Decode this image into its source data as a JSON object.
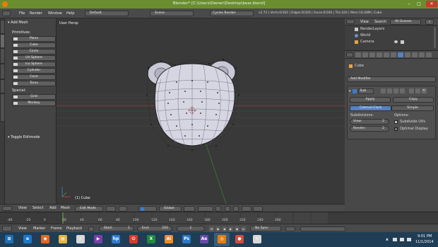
{
  "window": {
    "title": "Blender* [C:\\Users\\Owner\\Desktop\\bear.blend]",
    "minimize": "–",
    "maximize": "□",
    "close": "✕"
  },
  "info_header": {
    "menus": [
      "File",
      "Render",
      "Window",
      "Help"
    ],
    "screen_layout": "Default",
    "scene": "Scene",
    "render_engine": "Cycles Render",
    "stats": "v2.72 | Verts:0/162 | Edges:0/320 | Faces:0/160 | Tris:320 | Mem:16.08M | Cube"
  },
  "toolshelf": {
    "add_meshes_header": "Add Mesh",
    "primitives_label": "Primitives:",
    "primitives": [
      "Plane",
      "Cube",
      "Circle",
      "UV Sphere",
      "Ico Sphere",
      "Cylinder",
      "Cone",
      "Torus"
    ],
    "special_label": "Special:",
    "special": [
      "Grid",
      "Monkey"
    ],
    "toggle_editmode": "Toggle Editmode"
  },
  "viewport": {
    "view_label": "User Persp",
    "object_label": "(1) Cube"
  },
  "viewport_header": {
    "menus": [
      "View",
      "Select",
      "Add",
      "Mesh"
    ],
    "mode": "Edit Mode",
    "orientation": "Global"
  },
  "outliner": {
    "menus": [
      "View",
      "Search"
    ],
    "filter": "All Scenes",
    "items": [
      "RenderLayers",
      "World",
      "Camera"
    ]
  },
  "properties": {
    "object_name": "Cube",
    "add_modifier": "Add Modifier",
    "modifier_name": "Sub",
    "apply_button": "Apply",
    "copy_button": "Copy",
    "catmull_tab": "Catmull-Clark",
    "simple_tab": "Simple",
    "subdivisions_label": "Subdivisions:",
    "options_label": "Options:",
    "view_field": "View:",
    "view_value": "2",
    "render_field": "Render:",
    "render_value": "2",
    "subdivide_uvs": "Subdivide UVs",
    "optimal_display": "Optimal Display"
  },
  "timeline": {
    "ruler": [
      "-40",
      "-20",
      "0",
      "20",
      "40",
      "60",
      "80",
      "100",
      "120",
      "140",
      "160",
      "180",
      "200",
      "220",
      "240",
      "260"
    ],
    "menus": [
      "View",
      "Marker",
      "Frame",
      "Playback"
    ],
    "start_label": "Start:",
    "start_value": "1",
    "end_label": "End:",
    "end_value": "250",
    "current_frame": "1",
    "sync": "No Sync"
  },
  "taskbar": {
    "apps": [
      {
        "name": "ie",
        "color": "#1e78c8",
        "glyph": "e"
      },
      {
        "name": "firefox",
        "color": "#e8641e",
        "glyph": "◉"
      },
      {
        "name": "explorer",
        "color": "#e6b53c",
        "glyph": "▤"
      },
      {
        "name": "itunes",
        "color": "#d8d8d8",
        "glyph": "♪"
      },
      {
        "name": "media",
        "color": "#7a3fa8",
        "glyph": "▶"
      },
      {
        "name": "hp",
        "color": "#2f7bd1",
        "glyph": "hp"
      },
      {
        "name": "power",
        "color": "#d73a27",
        "glyph": "⏻"
      },
      {
        "name": "excel",
        "color": "#1f8a3c",
        "glyph": "X"
      },
      {
        "name": "illustrator",
        "color": "#f28c1e",
        "glyph": "Ai"
      },
      {
        "name": "photoshop",
        "color": "#2a78c6",
        "glyph": "Ps"
      },
      {
        "name": "aftereffects",
        "color": "#6a4aa8",
        "glyph": "Ae"
      },
      {
        "name": "blender",
        "color": "#e87d0d",
        "glyph": "◎"
      },
      {
        "name": "chrome",
        "color": "#d34b3b",
        "glyph": "●"
      },
      {
        "name": "paint",
        "color": "#d8d8d8",
        "glyph": "✎"
      }
    ],
    "time": "9:01 PM",
    "date": "11/1/2014"
  }
}
